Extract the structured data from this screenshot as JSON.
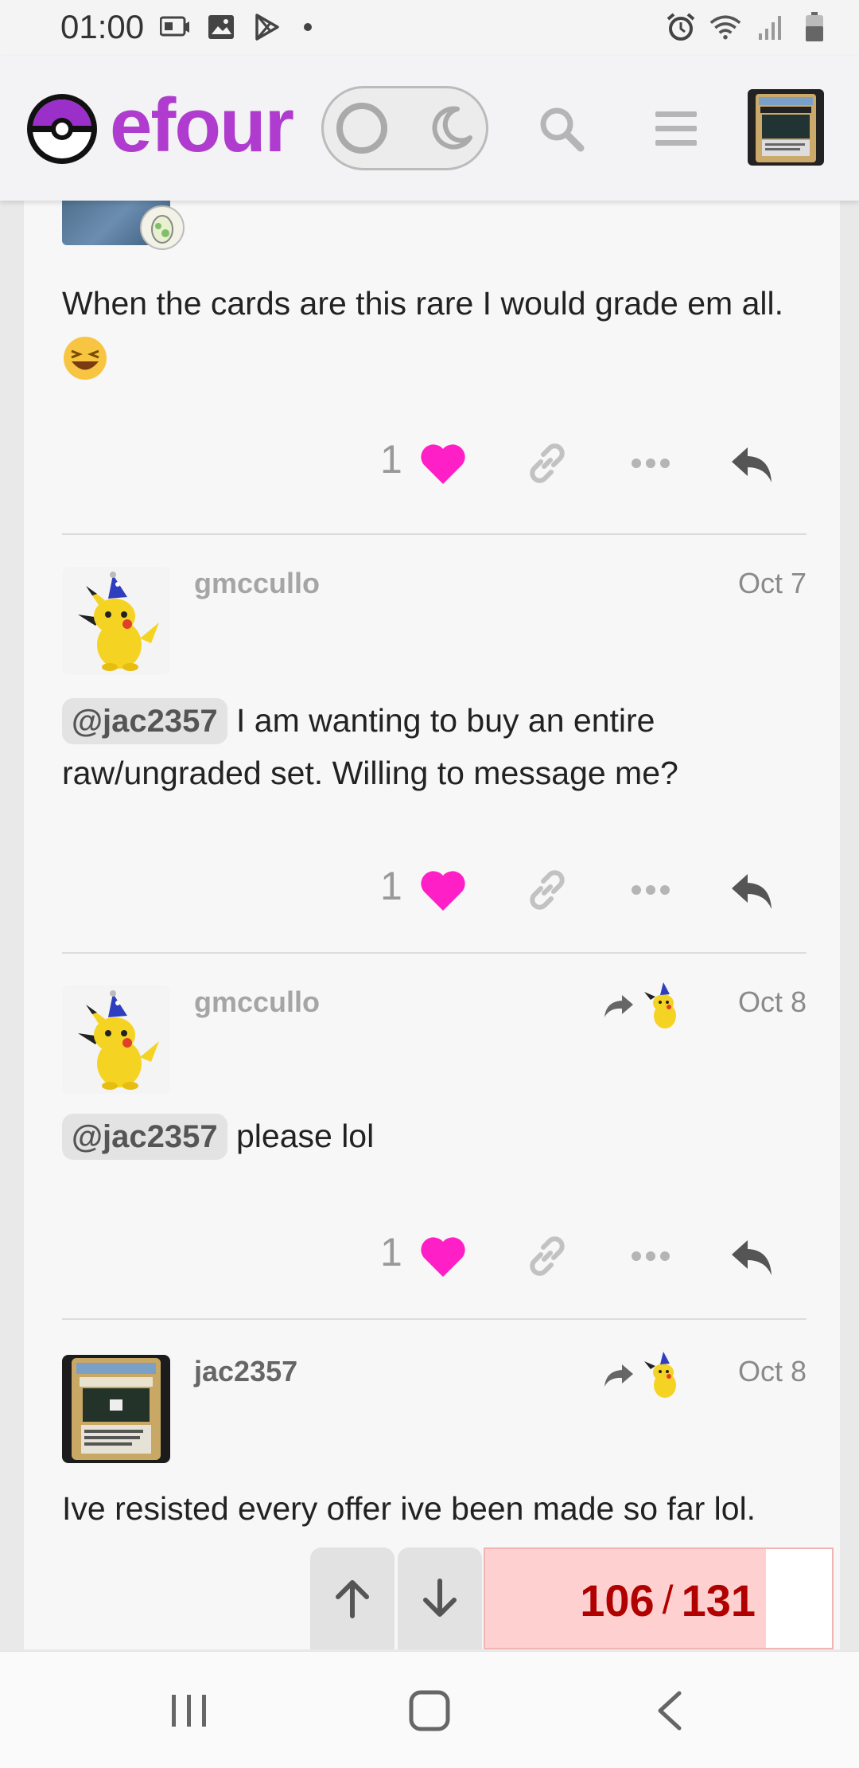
{
  "status_bar": {
    "time": "01:00"
  },
  "header": {
    "logo_text": "efour"
  },
  "posts": [
    {
      "text": "When the cards are this rare I would grade em all.",
      "likes": "1"
    },
    {
      "username": "gmccullo",
      "date": "Oct 7",
      "mention": "@jac2357",
      "text": " I am wanting to buy an entire raw/ungraded set. Willing to message me?",
      "likes": "1"
    },
    {
      "username": "gmccullo",
      "date": "Oct 8",
      "mention": "@jac2357",
      "text": " please lol",
      "likes": "1"
    },
    {
      "username": "jac2357",
      "date": "Oct 8",
      "text": "Ive resisted every offer ive been made so far lol."
    }
  ],
  "progress": {
    "current": "106",
    "separator": "/",
    "total": "131",
    "fraction": 0.8092
  },
  "colors": {
    "brand": "#b03ccf",
    "like": "#ff1fc6",
    "progress_text": "#b00000",
    "progress_fill": "#ffd0d0"
  },
  "icons": [
    "pokeball-logo-icon",
    "theme-toggle-icon",
    "search-icon",
    "hamburger-menu-icon",
    "heart-icon",
    "link-icon",
    "more-icon",
    "reply-icon",
    "arrow-up-icon",
    "arrow-down-icon"
  ]
}
